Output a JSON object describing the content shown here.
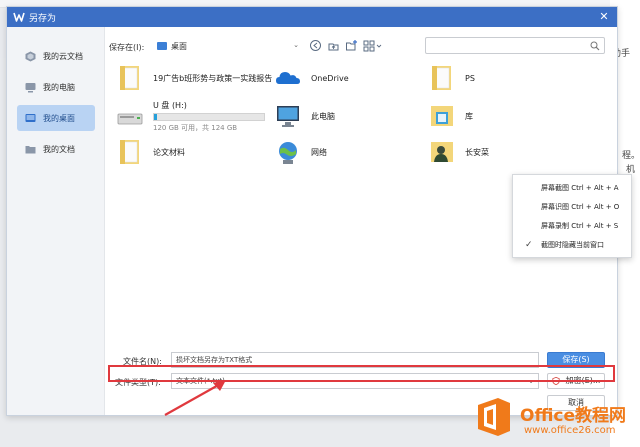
{
  "window": {
    "title": "另存为",
    "close_glyph": "✕"
  },
  "background": {
    "doc_text_1": "程。",
    "doc_text_2": "机",
    "doc_text_3": "助手"
  },
  "sidebar": {
    "items": [
      {
        "label": "我的云文档",
        "icon": "cloud-doc-icon",
        "active": false
      },
      {
        "label": "我的电脑",
        "icon": "computer-icon",
        "active": false
      },
      {
        "label": "我的桌面",
        "icon": "desktop-icon",
        "active": true
      },
      {
        "label": "我的文档",
        "icon": "folder-icon",
        "active": false
      }
    ]
  },
  "toolbar": {
    "save_in_label": "保存在(I):",
    "location": "桌面",
    "search_placeholder": ""
  },
  "files": {
    "folder_ad": "19广告b班形势与政策一实践报告",
    "onedrive": "OneDrive",
    "ps": "PS",
    "drive_name": "U 盘 (H:)",
    "drive_usage": "120 GB 可用，共 124 GB",
    "drive_used_fraction": 0.03,
    "this_pc": "此电脑",
    "library": "库",
    "thesis": "论文材料",
    "network": "网络",
    "user": "长安菜"
  },
  "form": {
    "filename_label": "文件名(N):",
    "filename_value": "损坏文档另存为TXT格式",
    "filetype_label": "文件类型(T):",
    "filetype_value": "文本文件(*.txt)",
    "save_button": "保存(S)",
    "encrypt_button": "加密(E)...",
    "cancel_button": "取消"
  },
  "context_menu": {
    "items": [
      {
        "label": "屏幕截图 Ctrl + Alt + A",
        "checked": false
      },
      {
        "label": "屏幕识图 Ctrl + Alt + O",
        "checked": false
      },
      {
        "label": "屏幕录制 Ctrl + Alt + S",
        "checked": false
      },
      {
        "label": "截图时隐藏当前窗口",
        "checked": true
      }
    ],
    "check_glyph": "✓"
  },
  "watermark": {
    "title": "Office教程网",
    "url": "www.office26.com"
  },
  "colors": {
    "titlebar": "#3c6fc5",
    "sidebar_active": "#b9d3f3",
    "primary_button": "#4a8ee2",
    "highlight": "#e0393e",
    "watermark": "#f07a1a"
  }
}
